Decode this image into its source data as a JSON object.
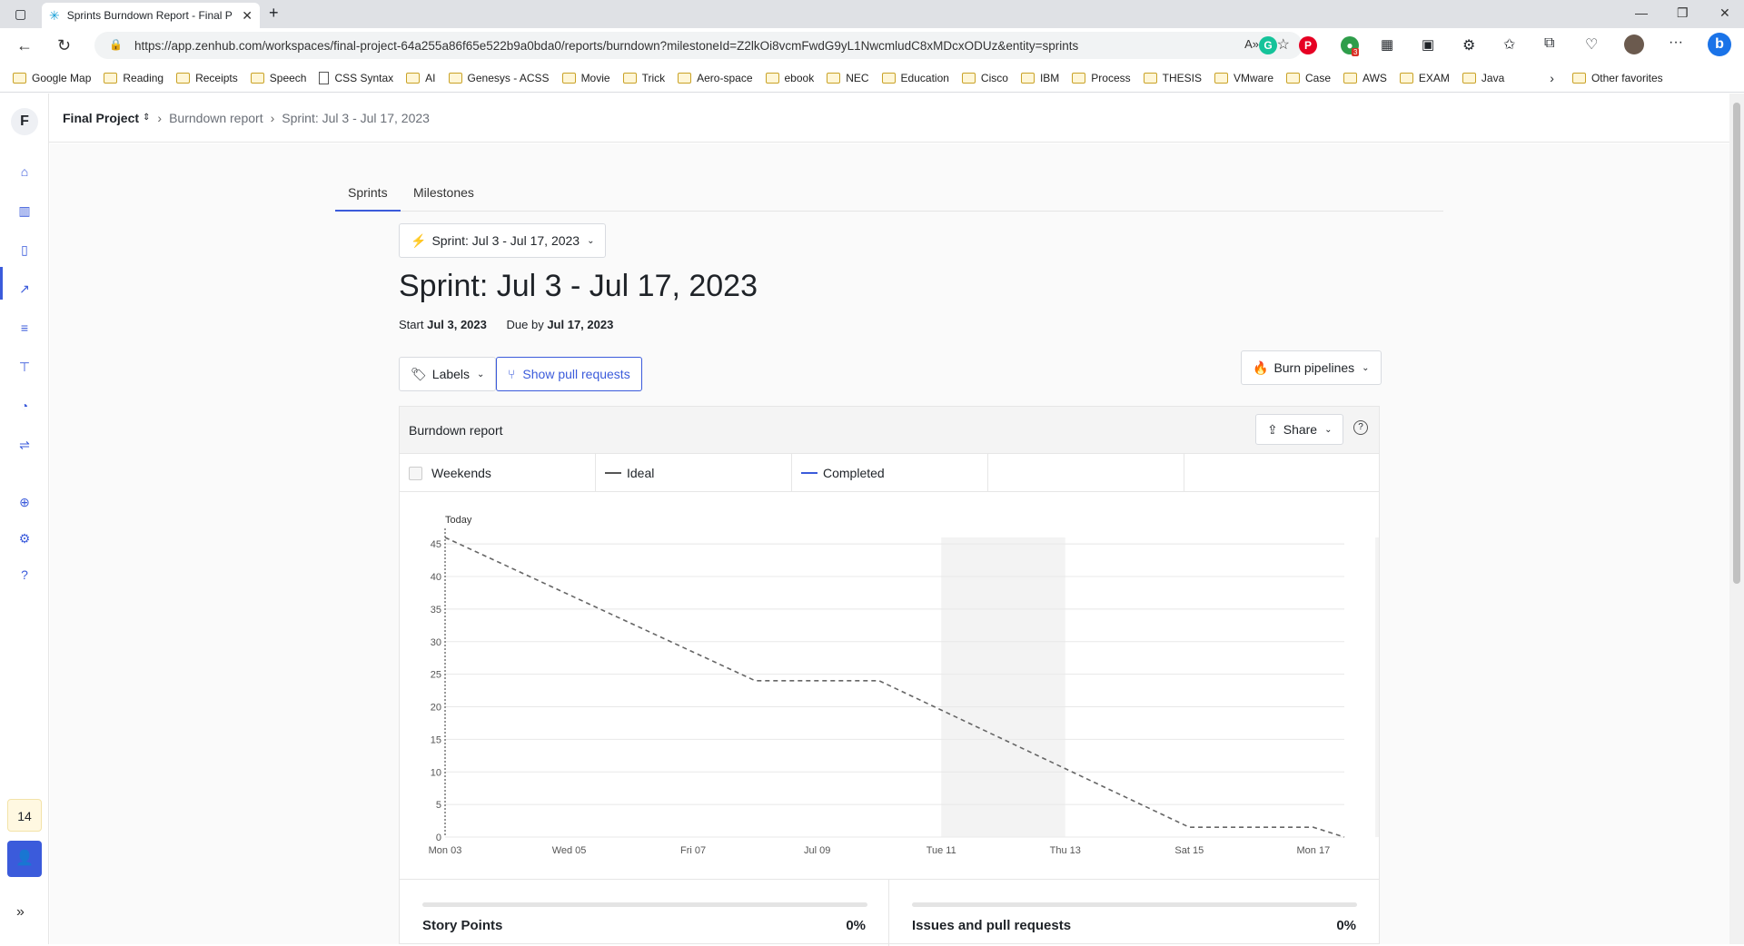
{
  "browser": {
    "tab_title": "Sprints Burndown Report - Final P",
    "url": "https://app.zenhub.com/workspaces/final-project-64a255a86f65e522b9a0bda0/reports/burndown?milestoneId=Z2lkOi8vcmFwdG9yL1NwcmludC8xMDcxODUz&entity=sprints",
    "bookmarks": [
      "Google Map",
      "Reading",
      "Receipts",
      "Speech",
      "CSS Syntax",
      "AI",
      "Genesys - ACSS",
      "Movie",
      "Trick",
      "Aero-space",
      "ebook",
      "NEC",
      "Education",
      "Cisco",
      "IBM",
      "Process",
      "THESIS",
      "VMware",
      "Case",
      "AWS",
      "EXAM",
      "Java"
    ],
    "other_favorites": "Other favorites",
    "extension_badge": "3"
  },
  "sidebar": {
    "workspace_initial": "F",
    "count": "14"
  },
  "breadcrumb": {
    "workspace": "Final Project",
    "report": "Burndown report",
    "current": "Sprint: Jul 3 - Jul 17, 2023"
  },
  "tabs": [
    "Sprints",
    "Milestones"
  ],
  "sprint_select": "Sprint: Jul 3 - Jul 17, 2023",
  "sprint": {
    "title": "Sprint: Jul 3 - Jul 17, 2023",
    "start_label": "Start",
    "start": "Jul 3, 2023",
    "due_label": "Due by",
    "due": "Jul 17, 2023"
  },
  "toolbar": {
    "labels": "Labels",
    "show_pull_requests": "Show pull requests",
    "burn_pipelines": "Burn pipelines"
  },
  "report": {
    "title": "Burndown report",
    "share": "Share",
    "legend": {
      "weekends": "Weekends",
      "ideal": "Ideal",
      "completed": "Completed"
    }
  },
  "chart_data": {
    "type": "line",
    "x_ticks": [
      "Mon 03",
      "Wed 05",
      "Fri 07",
      "Jul 09",
      "Tue 11",
      "Thu 13",
      "Sat 15",
      "Mon 17"
    ],
    "y_ticks": [
      0,
      5,
      10,
      15,
      20,
      25,
      30,
      35,
      40,
      45
    ],
    "ylim": [
      0,
      46
    ],
    "today_label": "Today",
    "weekend_shading": [
      [
        8,
        10
      ],
      [
        15,
        17
      ]
    ],
    "series": [
      {
        "name": "Ideal",
        "style": "dashed",
        "color": "#666666",
        "x": [
          0,
          5,
          7,
          12,
          14,
          14.5
        ],
        "y": [
          46,
          24,
          24,
          1.5,
          1.5,
          0
        ]
      }
    ],
    "grid": true
  },
  "stats": [
    {
      "name": "Story Points",
      "value": "0%"
    },
    {
      "name": "Issues and pull requests",
      "value": "0%"
    }
  ]
}
